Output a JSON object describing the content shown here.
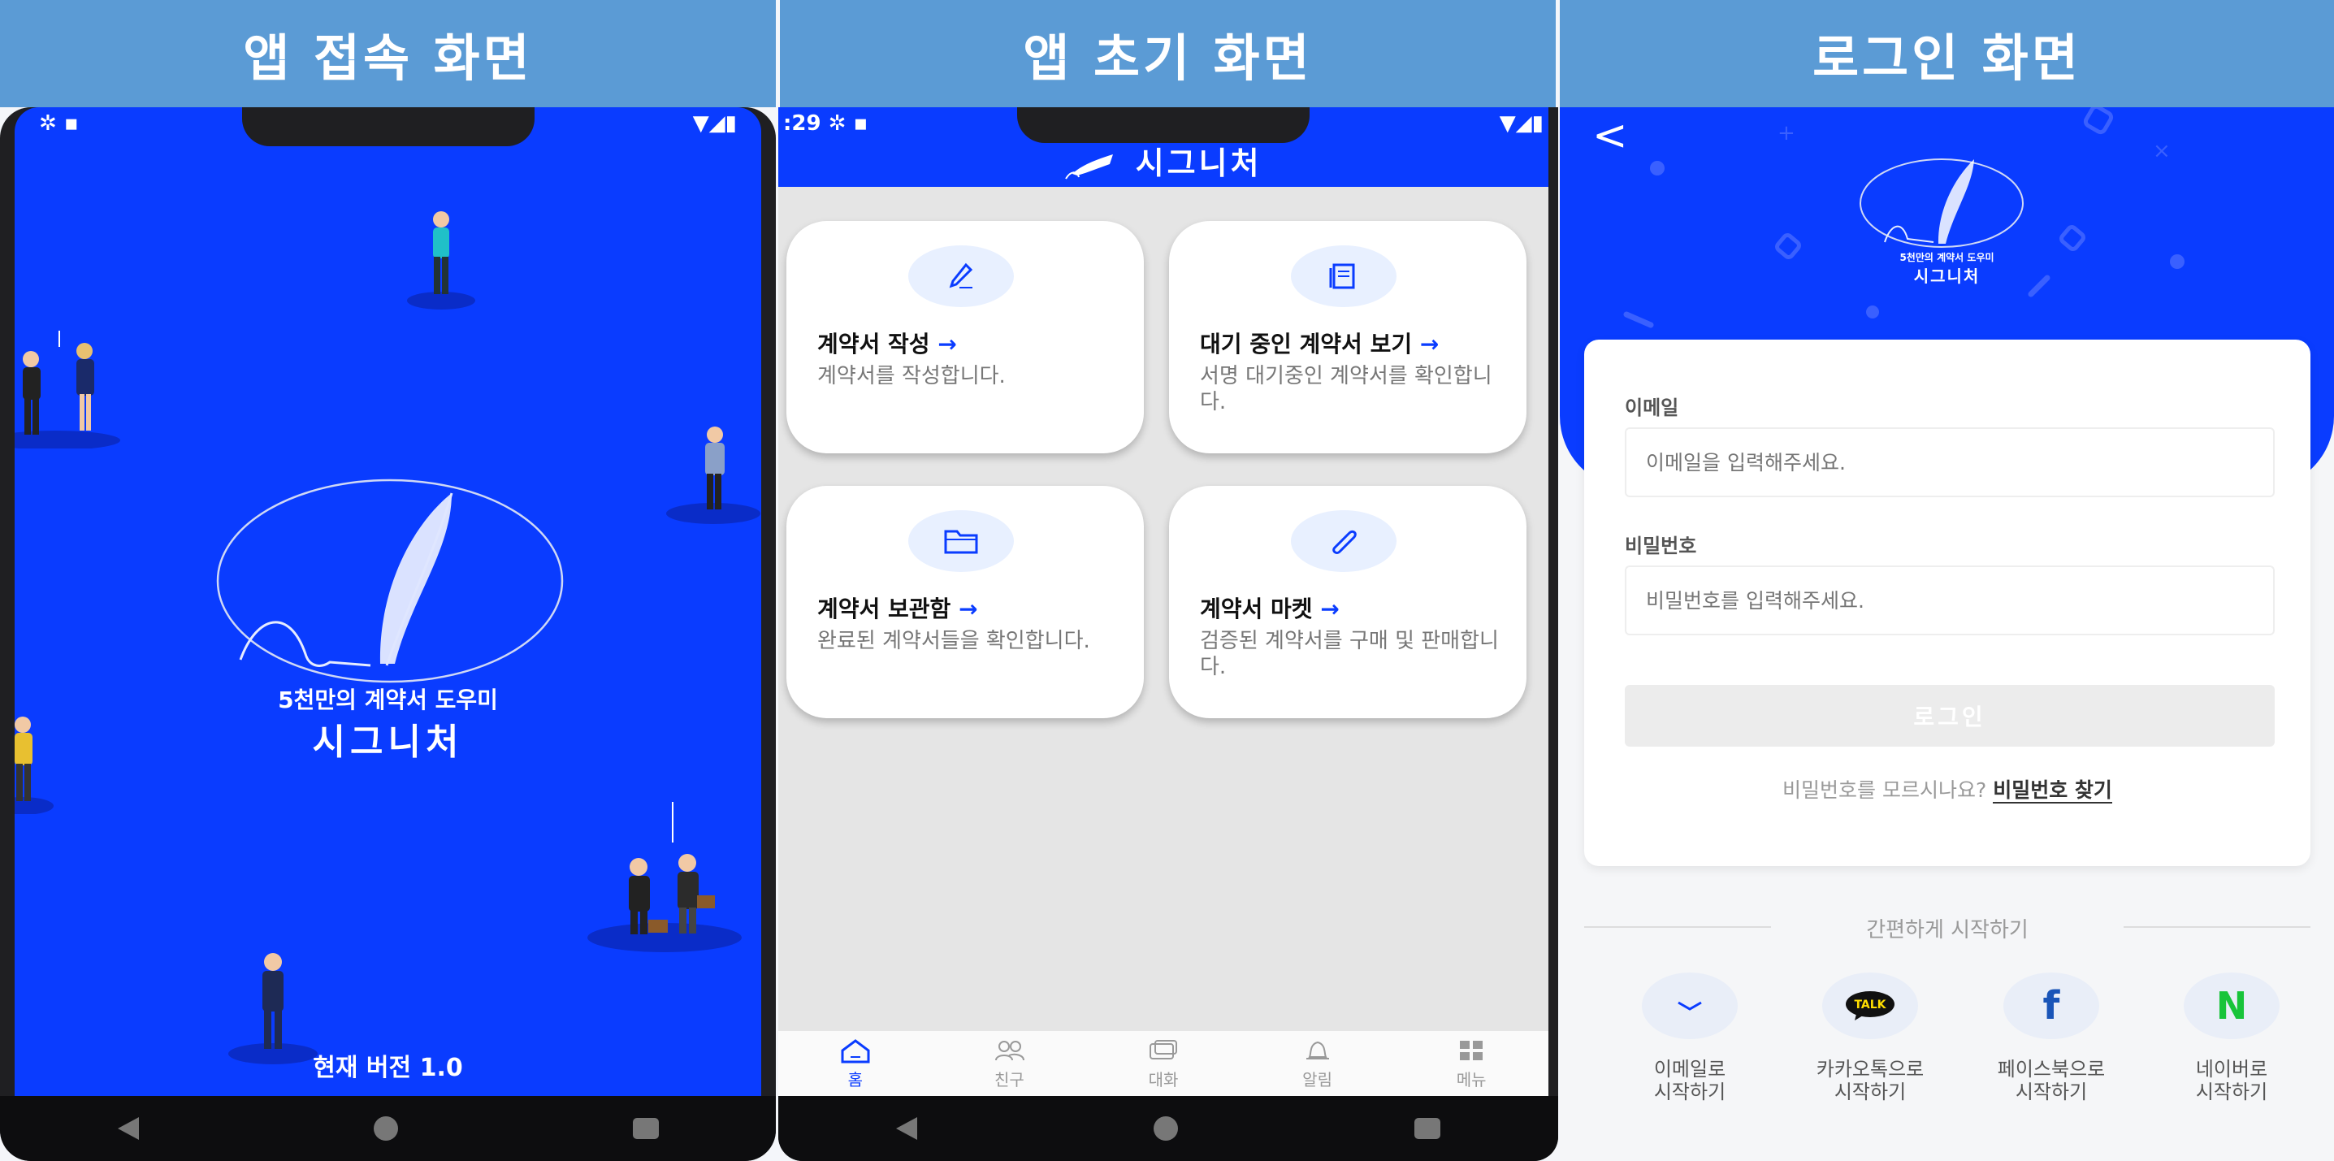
{
  "headers": [
    "앱 접속 화면",
    "앱 초기 화면",
    "로그인 화면"
  ],
  "splash": {
    "subtitle": "5천만의 계약서 도우미",
    "app_name": "시그니처",
    "version": "현재 버전 1.0"
  },
  "home": {
    "status_time": ":29",
    "app_title": "시그니처",
    "cards": [
      {
        "title": "계약서 작성",
        "arrow": "→",
        "desc": "계약서를 작성합니다.",
        "icon": "pen-icon"
      },
      {
        "title": "대기 중인 계약서 보기",
        "arrow": "→",
        "desc": "서명 대기중인 계약서를 확인합니다.",
        "icon": "document-icon"
      },
      {
        "title": "계약서 보관함",
        "arrow": "→",
        "desc": "완료된 계약서들을 확인합니다.",
        "icon": "folder-icon"
      },
      {
        "title": "계약서 마켓",
        "arrow": "→",
        "desc": "검증된 계약서를 구매 및 판매합니다.",
        "icon": "paperclip-icon"
      }
    ],
    "tabs": [
      "홈",
      "친구",
      "대화",
      "알림",
      "메뉴"
    ],
    "accent": "#0a3cff"
  },
  "login": {
    "back": "<",
    "logo_sub": "5천만의 계약서 도우미",
    "logo_title": "시그니처",
    "email_label": "이메일",
    "email_placeholder": "이메일을 입력해주세요.",
    "password_label": "비밀번호",
    "password_placeholder": "비밀번호를 입력해주세요.",
    "login_button": "로그인",
    "forgot_text": "비밀번호를 모르시나요?",
    "forgot_link": "비밀번호 찾기",
    "easy_start": "간편하게 시작하기",
    "social": [
      {
        "label1": "이메일로",
        "label2": "시작하기",
        "icon": "email-icon"
      },
      {
        "label1": "카카오톡으로",
        "label2": "시작하기",
        "icon": "kakaotalk-icon",
        "badge": "TALK"
      },
      {
        "label1": "페이스북으로",
        "label2": "시작하기",
        "icon": "facebook-icon",
        "badge": "f"
      },
      {
        "label1": "네이버로",
        "label2": "시작하기",
        "icon": "naver-icon",
        "badge": "N"
      }
    ]
  }
}
